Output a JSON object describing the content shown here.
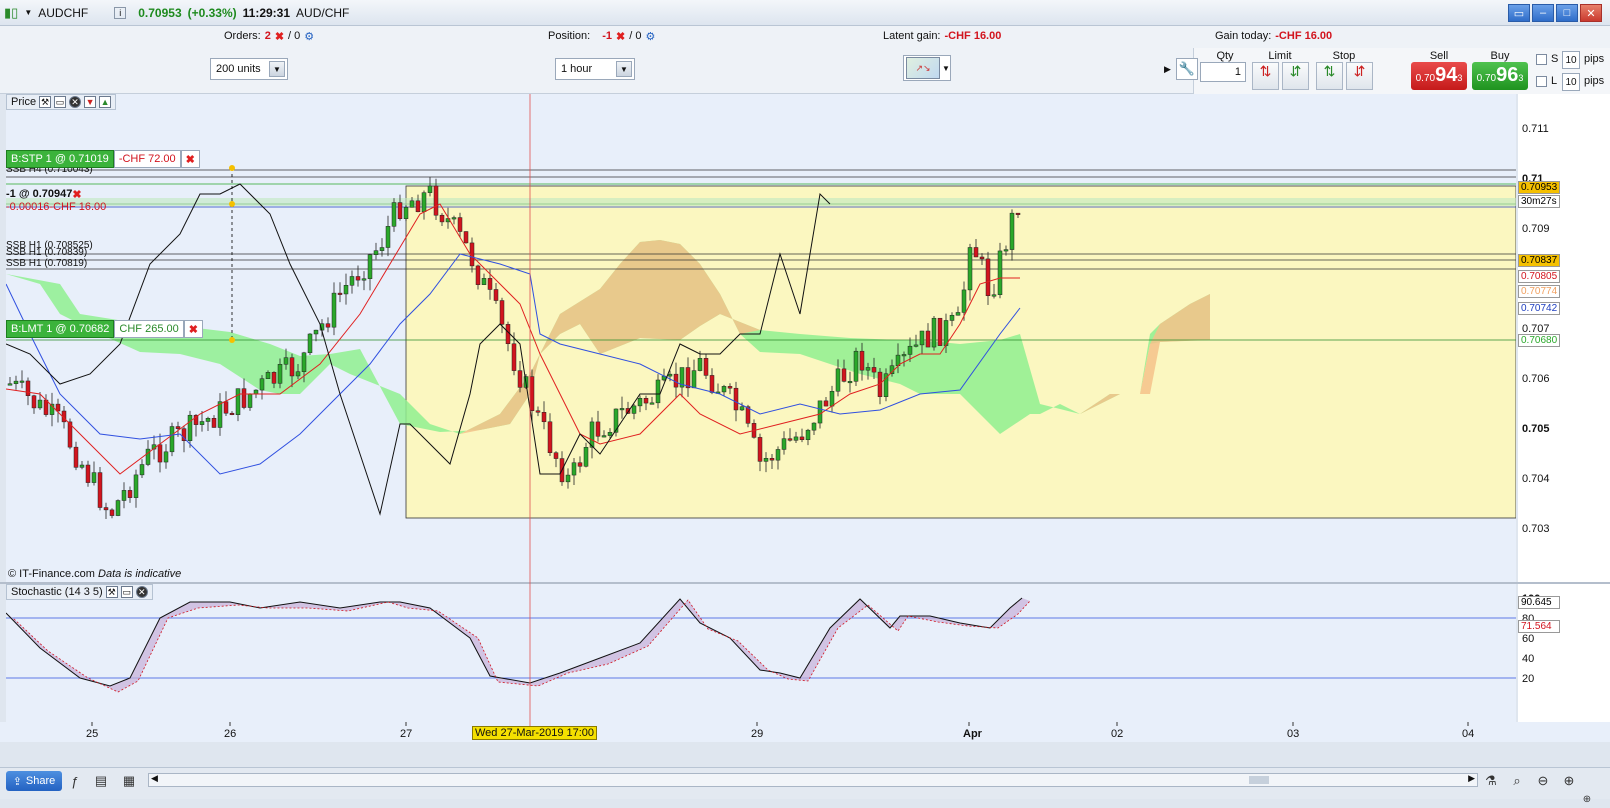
{
  "title": {
    "symbol": "AUDCHF",
    "price": "0.70953",
    "change": "(+0.33%)",
    "time": "11:29:31",
    "name": "AUD/CHF"
  },
  "info": {
    "orders_label": "Orders:",
    "orders_count": "2",
    "orders_sep": "/ 0",
    "position_label": "Position:",
    "position_value": "-1",
    "position_sep": "/ 0",
    "latent_label": "Latent gain:",
    "latent_value": "-CHF 16.00",
    "gain_label": "Gain today:",
    "gain_value": "-CHF 16.00"
  },
  "toolbar": {
    "units": "200 units",
    "timeframe": "1 hour"
  },
  "trade": {
    "qty_label": "Qty",
    "qty_value": "1",
    "limit_label": "Limit",
    "stop_label": "Stop",
    "sell_label": "Sell",
    "buy_label": "Buy",
    "sell_small": "0.70",
    "sell_big": "94",
    "sell_sup": "3",
    "buy_small": "0.70",
    "buy_big": "96",
    "buy_sup": "3",
    "s_label": "S",
    "l_label": "L",
    "pips1": "10",
    "pips2": "10",
    "pips_label": "pips"
  },
  "price_panel": {
    "title": "Price",
    "watermark": "© IT-Finance.com",
    "indicative": "Data is indicative",
    "stop_order": "B:STP  1 @ 0.71019",
    "stop_value": "-CHF 72.00",
    "position_tag": "-1 @ 0.70947",
    "position_diff": "-0.00016",
    "position_pnl": "-CHF 16.00",
    "limit_order": "B:LMT  1 @ 0.70682",
    "limit_value": "CHF 265.00",
    "ssb_h4": "SSB H4 (0.710043)",
    "ssb_h1a": "SSB H1 (0.708525)",
    "ssb_h1b": "SSB H1 (0.70819)",
    "ssb_h1c": "SSB H1 (0.70839)"
  },
  "stoch_panel": {
    "title": "Stochastic (14 3 5)"
  },
  "price_axis": [
    "0.711",
    "0.71",
    "0.709",
    "0.708",
    "0.707",
    "0.706",
    "0.705",
    "0.704",
    "0.703"
  ],
  "price_tags": [
    {
      "text": "0.70953",
      "bg": "#f5c000",
      "fg": "#000"
    },
    {
      "text": "30m27s",
      "bg": "#ffffff",
      "fg": "#000"
    },
    {
      "text": "0.70837",
      "bg": "#f5c000",
      "fg": "#000"
    },
    {
      "text": "0.70805",
      "bg": "#ffffff",
      "fg": "#d2141e"
    },
    {
      "text": "0.70774",
      "bg": "#ffffff",
      "fg": "#f0a060"
    },
    {
      "text": "0.70742",
      "bg": "#ffffff",
      "fg": "#2040c0"
    },
    {
      "text": "0.70680",
      "bg": "#ffffff",
      "fg": "#2aa82a"
    }
  ],
  "stoch_axis": [
    "100",
    "80",
    "60",
    "40",
    "20"
  ],
  "stoch_tags": [
    {
      "text": "90.645",
      "bg": "#ffffff",
      "fg": "#000"
    },
    {
      "text": "71.564",
      "bg": "#ffffff",
      "fg": "#d2141e"
    }
  ],
  "time_axis": [
    "25",
    "26",
    "27",
    "29",
    "Apr",
    "02",
    "03",
    "04"
  ],
  "crosshair_label": "Wed 27-Mar-2019 17:00",
  "bottom": {
    "share": "Share"
  },
  "colors": {
    "bull": "#2aa82a",
    "bear": "#d2141e",
    "cloud_green": "#8ff08f",
    "cloud_orange": "#f5c28a",
    "zone_yellow": "#fbf7c0"
  }
}
